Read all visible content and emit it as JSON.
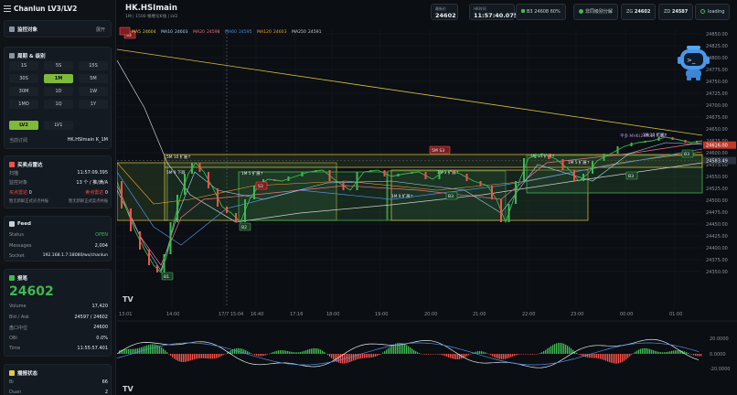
{
  "app": {
    "title": "Chanlun LV3/LV2"
  },
  "sidebar": {
    "monitor": {
      "title": "监控对象",
      "expand": "展开"
    },
    "period": {
      "title": "周期 & 级别",
      "buttons": [
        "1S",
        "5S",
        "15S",
        "30S",
        "1M",
        "5M",
        "30M",
        "1D",
        "1W",
        "1MO",
        "1Q",
        "1Y"
      ],
      "active": "1M",
      "levels": [
        "LV2",
        "LV1"
      ],
      "active_level": "LV2",
      "subscription_label": "当前订阅",
      "subscription_value": "HK.HSImain K_1M"
    },
    "realtime": {
      "title": "买卖点雷达",
      "rows": [
        {
          "k": "扫描",
          "v": "11:57:09.395"
        },
        {
          "k": "监控对象",
          "v": "13 个 / 推/满/A"
        }
      ],
      "buy_label": "买点雷达",
      "buy_value": "0",
      "sell_label": "卖点雷达",
      "sell_value": "0",
      "buy_note": "暂无新鲜正式买点共振",
      "sell_note": "暂无新鲜正式卖点共振"
    },
    "feed": {
      "title": "Feed",
      "rows": [
        {
          "k": "Status",
          "v": "OPEN"
        },
        {
          "k": "Messages",
          "v": "2,004"
        },
        {
          "k": "Socket",
          "v": "192.168.1.7:18080/ws/chanlun"
        }
      ]
    },
    "quote": {
      "title": "报笔",
      "price": "24602",
      "rows": [
        {
          "k": "Volume",
          "v": "17,420"
        },
        {
          "k": "Bid / Ask",
          "v": "24597 / 24602"
        },
        {
          "k": "盘口中位",
          "v": "24600"
        },
        {
          "k": "OBI",
          "v": "0.0%"
        },
        {
          "k": "Time",
          "v": "11:55:57.401"
        }
      ]
    },
    "sync": {
      "title": "播报状态",
      "rows": [
        {
          "k": "Bi",
          "v": "66"
        },
        {
          "k": "Duan",
          "v": "2"
        }
      ]
    }
  },
  "header": {
    "symbol": "HK.HSImain",
    "subtitle": "1M | 1500 根缠论K线 | LV2",
    "latest_label": "最新价",
    "latest_value": "24602",
    "hk_time_label": "HK时间",
    "hk_time_value": "11:57:40.075",
    "b3": "B3 24608 60%",
    "nonsync": "非同级别分解",
    "zg_label": "ZG",
    "zg_value": "24602",
    "zd_label": "ZD",
    "zd_value": "24587",
    "loading": "loading"
  },
  "chart": {
    "ma_legend": [
      {
        "name": "MA5",
        "value": "24604",
        "color": "#e3c84a"
      },
      {
        "name": "MA10",
        "value": "24603",
        "color": "#a8d8f0"
      },
      {
        "name": "MA20",
        "value": "24598",
        "color": "#f0708a"
      },
      {
        "name": "MA60",
        "value": "24595",
        "color": "#4f8fe0"
      },
      {
        "name": "MA120",
        "value": "24603",
        "color": "#f0a030"
      },
      {
        "name": "MA250",
        "value": "24591",
        "color": "#d0d0d0"
      }
    ],
    "price_ticks": [
      "24850.00",
      "24825.00",
      "24800.00",
      "24775.00",
      "24750.00",
      "24725.00",
      "24700.00",
      "24675.00",
      "24650.00",
      "24625.00",
      "24600.00",
      "24575.00",
      "24550.00",
      "24525.00",
      "24500.00",
      "24475.00",
      "24450.00",
      "24425.00",
      "24400.00",
      "24375.00",
      "24350.00"
    ],
    "crosshair_price": "24583.49",
    "last_price_tag": "24616.00",
    "time_ticks": [
      "13:01",
      "14:00",
      "17/7 15:04",
      "16:40",
      "17:16",
      "18:00",
      "19:00",
      "20:00",
      "21:00",
      "22:00",
      "23:00",
      "00:00",
      "01:00"
    ],
    "markers": [
      {
        "label": "S3",
        "kind": "sell"
      },
      {
        "label": "B1",
        "kind": "buy"
      },
      {
        "label": "B2",
        "kind": "buy"
      },
      {
        "label": "S3",
        "kind": "sell"
      },
      {
        "label": "5M S3",
        "kind": "sell"
      },
      {
        "label": "B3",
        "kind": "buy"
      },
      {
        "label": "B3",
        "kind": "buy"
      },
      {
        "label": "B3",
        "kind": "buy"
      }
    ],
    "zhongshu_labels": [
      "5M 10 扩展↑",
      "5M 9 下跌",
      "1M 5 扩展↑",
      "1M 9 扩展↑",
      "1M 3 扩展↑",
      "1M 15 扩展↑",
      "1M 5 扩展↑",
      "1M 10 扩展↑"
    ],
    "annotation": "平多 MH6(24602) -182",
    "logo": "TV",
    "colors": {
      "up": "#3fb950",
      "down": "#f85149",
      "bg": "#0b0e13",
      "grid": "#171c23"
    }
  },
  "osc": {
    "ticks": [
      "20.0000",
      "0.0000",
      "-20.0000"
    ]
  }
}
